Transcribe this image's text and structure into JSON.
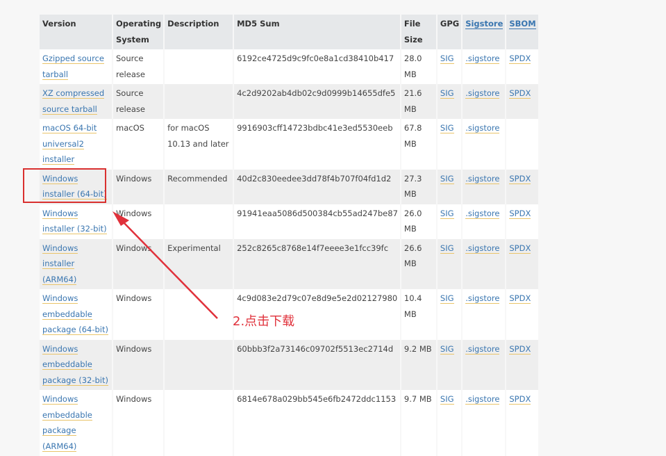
{
  "headers": [
    "Version",
    "Operating System",
    "Description",
    "MD5 Sum",
    "File Size",
    "GPG",
    "Sigstore",
    "SBOM"
  ],
  "rows": [
    {
      "version": "Gzipped source tarball",
      "os": "Source release",
      "description": "",
      "md5": "6192ce4725d9c9fc0e8a1cd38410b417",
      "size": "28.0 MB",
      "gpg": "SIG",
      "sigstore": ".sigstore",
      "sbom": "SPDX"
    },
    {
      "version": "XZ compressed source tarball",
      "os": "Source release",
      "description": "",
      "md5": "4c2d9202ab4db02c9d0999b14655dfe5",
      "size": "21.6 MB",
      "gpg": "SIG",
      "sigstore": ".sigstore",
      "sbom": "SPDX"
    },
    {
      "version": "macOS 64-bit universal2 installer",
      "os": "macOS",
      "description": "for macOS 10.13 and later",
      "md5": "9916903cff14723bdbc41e3ed5530eeb",
      "size": "67.8 MB",
      "gpg": "SIG",
      "sigstore": ".sigstore",
      "sbom": ""
    },
    {
      "version": "Windows installer (64-bit)",
      "os": "Windows",
      "description": "Recommended",
      "md5": "40d2c830eedee3dd78f4b707f04fd1d2",
      "size": "27.3 MB",
      "gpg": "SIG",
      "sigstore": ".sigstore",
      "sbom": "SPDX"
    },
    {
      "version": "Windows installer (32-bit)",
      "os": "Windows",
      "description": "",
      "md5": "91941eaa5086d500384cb55ad247be87",
      "size": "26.0 MB",
      "gpg": "SIG",
      "sigstore": ".sigstore",
      "sbom": "SPDX"
    },
    {
      "version": "Windows installer (ARM64)",
      "os": "Windows",
      "description": "Experimental",
      "md5": "252c8265c8768e14f7eeee3e1fcc39fc",
      "size": "26.6 MB",
      "gpg": "SIG",
      "sigstore": ".sigstore",
      "sbom": "SPDX"
    },
    {
      "version": "Windows embeddable package (64-bit)",
      "os": "Windows",
      "description": "",
      "md5": "4c9d083e2d79c07e8d9e5e2d02127980",
      "size": "10.4 MB",
      "gpg": "SIG",
      "sigstore": ".sigstore",
      "sbom": "SPDX"
    },
    {
      "version": "Windows embeddable package (32-bit)",
      "os": "Windows",
      "description": "",
      "md5": "60bbb3f2a73146c09702f5513ec2714d",
      "size": "9.2 MB",
      "gpg": "SIG",
      "sigstore": ".sigstore",
      "sbom": "SPDX"
    },
    {
      "version": "Windows embeddable package (ARM64)",
      "os": "Windows",
      "description": "",
      "md5": "6814e678a029bb545e6fb2472ddc1153",
      "size": "9.7 MB",
      "gpg": "SIG",
      "sigstore": ".sigstore",
      "sbom": "SPDX"
    }
  ],
  "annotation": {
    "text": "2.点击下载",
    "color": "#e0313b"
  },
  "colors": {
    "link": "#3a76b0",
    "underline": "#e9c46a",
    "highlight": "#d9302f"
  }
}
